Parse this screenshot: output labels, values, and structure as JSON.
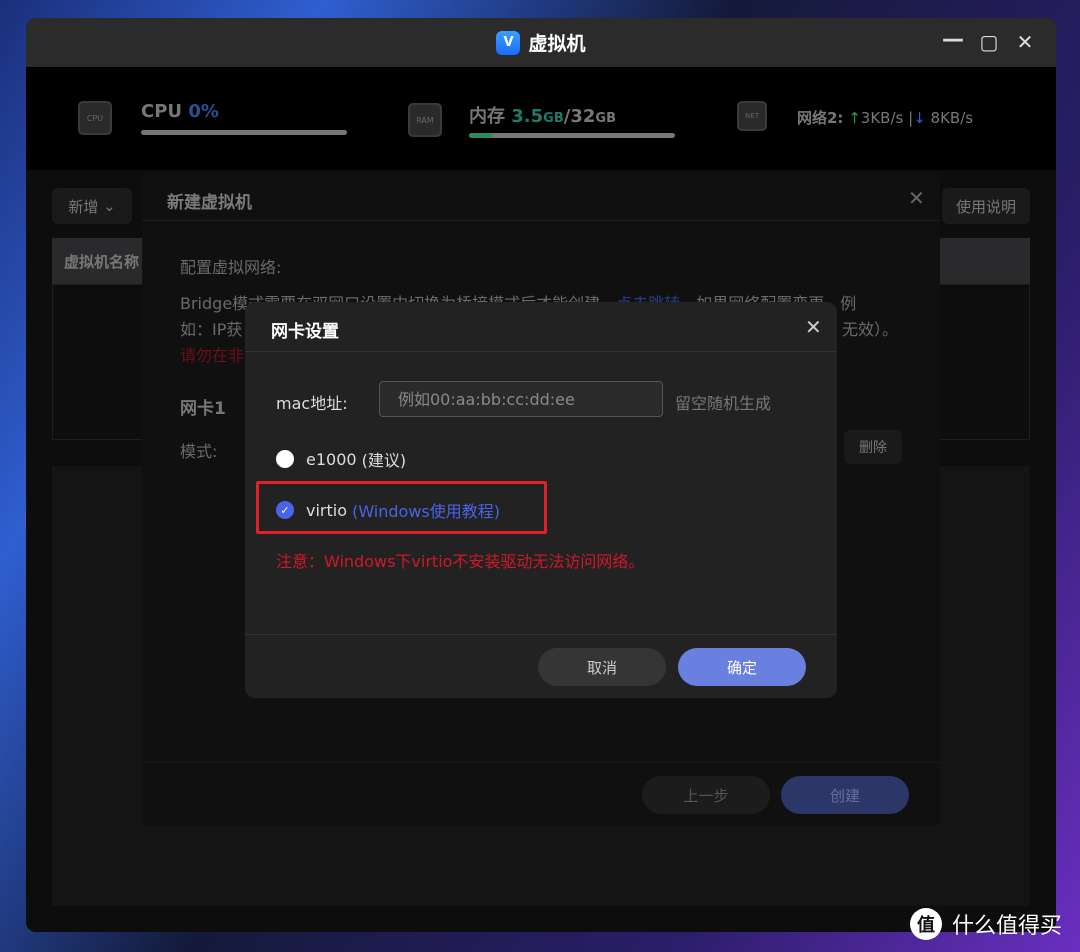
{
  "window": {
    "title": "虚拟机",
    "app_icon": "V"
  },
  "stats": {
    "cpu": {
      "label": "CPU",
      "value": "0%",
      "progress_percent": 0,
      "icon_text": "CPU"
    },
    "memory": {
      "label": "内存",
      "used": "3.5",
      "used_unit": "GB",
      "sep": "/",
      "total": "32",
      "total_unit": "GB",
      "progress_percent": 11,
      "icon_text": "RAM"
    },
    "network": {
      "label": "网络2:",
      "up": "3KB/s",
      "sep": "|",
      "down": "8KB/s",
      "icon_text": "NET",
      "up_color": "#2e9b2e",
      "down_color": "#2b5fd6"
    }
  },
  "toolbar": {
    "add_label": "新增",
    "help_label": "使用说明"
  },
  "table": {
    "col_name": "虚拟机名称"
  },
  "create_dialog": {
    "title": "新建虚拟机",
    "section": "配置虚拟网络:",
    "desc_start": "Bridge模式需要在双网口设置中切换为桥接模式后才能创建，",
    "desc_link": "点击跳转",
    "desc_end": "，如果网络配置变更，例",
    "desc_line2_start": "如：IP获",
    "desc_line2_end": "无效）。",
    "warn_partial": "请勿在非",
    "nic_title": "网卡1",
    "mode_label": "模式:",
    "delete_label": "删除",
    "prev_label": "上一步",
    "create_label": "创建"
  },
  "nic_dialog": {
    "title": "网卡设置",
    "mac_label": "mac地址:",
    "mac_value": "",
    "mac_placeholder": "例如00:aa:bb:cc:dd:ee",
    "mac_hint": "留空随机生成",
    "options": [
      {
        "label": "e1000",
        "note": "(建议)",
        "selected": false
      },
      {
        "label": "virtio",
        "note": "(Windows使用教程)",
        "selected": true
      }
    ],
    "warning": "注意：Windows下virtio不安装驱动无法访问网络。",
    "cancel_label": "取消",
    "ok_label": "确定",
    "accent": "#6a80e0",
    "highlight_color": "#e0202a"
  },
  "watermark": {
    "icon": "值",
    "text": "什么值得买"
  }
}
